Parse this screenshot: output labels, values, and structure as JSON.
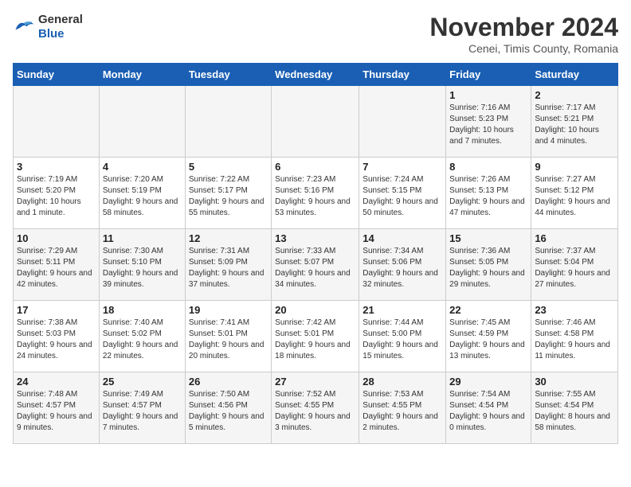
{
  "header": {
    "logo_general": "General",
    "logo_blue": "Blue",
    "main_title": "November 2024",
    "subtitle": "Cenei, Timis County, Romania"
  },
  "columns": [
    "Sunday",
    "Monday",
    "Tuesday",
    "Wednesday",
    "Thursday",
    "Friday",
    "Saturday"
  ],
  "weeks": [
    [
      {
        "day": "",
        "info": ""
      },
      {
        "day": "",
        "info": ""
      },
      {
        "day": "",
        "info": ""
      },
      {
        "day": "",
        "info": ""
      },
      {
        "day": "",
        "info": ""
      },
      {
        "day": "1",
        "info": "Sunrise: 7:16 AM\nSunset: 5:23 PM\nDaylight: 10 hours and 7 minutes."
      },
      {
        "day": "2",
        "info": "Sunrise: 7:17 AM\nSunset: 5:21 PM\nDaylight: 10 hours and 4 minutes."
      }
    ],
    [
      {
        "day": "3",
        "info": "Sunrise: 7:19 AM\nSunset: 5:20 PM\nDaylight: 10 hours and 1 minute."
      },
      {
        "day": "4",
        "info": "Sunrise: 7:20 AM\nSunset: 5:19 PM\nDaylight: 9 hours and 58 minutes."
      },
      {
        "day": "5",
        "info": "Sunrise: 7:22 AM\nSunset: 5:17 PM\nDaylight: 9 hours and 55 minutes."
      },
      {
        "day": "6",
        "info": "Sunrise: 7:23 AM\nSunset: 5:16 PM\nDaylight: 9 hours and 53 minutes."
      },
      {
        "day": "7",
        "info": "Sunrise: 7:24 AM\nSunset: 5:15 PM\nDaylight: 9 hours and 50 minutes."
      },
      {
        "day": "8",
        "info": "Sunrise: 7:26 AM\nSunset: 5:13 PM\nDaylight: 9 hours and 47 minutes."
      },
      {
        "day": "9",
        "info": "Sunrise: 7:27 AM\nSunset: 5:12 PM\nDaylight: 9 hours and 44 minutes."
      }
    ],
    [
      {
        "day": "10",
        "info": "Sunrise: 7:29 AM\nSunset: 5:11 PM\nDaylight: 9 hours and 42 minutes."
      },
      {
        "day": "11",
        "info": "Sunrise: 7:30 AM\nSunset: 5:10 PM\nDaylight: 9 hours and 39 minutes."
      },
      {
        "day": "12",
        "info": "Sunrise: 7:31 AM\nSunset: 5:09 PM\nDaylight: 9 hours and 37 minutes."
      },
      {
        "day": "13",
        "info": "Sunrise: 7:33 AM\nSunset: 5:07 PM\nDaylight: 9 hours and 34 minutes."
      },
      {
        "day": "14",
        "info": "Sunrise: 7:34 AM\nSunset: 5:06 PM\nDaylight: 9 hours and 32 minutes."
      },
      {
        "day": "15",
        "info": "Sunrise: 7:36 AM\nSunset: 5:05 PM\nDaylight: 9 hours and 29 minutes."
      },
      {
        "day": "16",
        "info": "Sunrise: 7:37 AM\nSunset: 5:04 PM\nDaylight: 9 hours and 27 minutes."
      }
    ],
    [
      {
        "day": "17",
        "info": "Sunrise: 7:38 AM\nSunset: 5:03 PM\nDaylight: 9 hours and 24 minutes."
      },
      {
        "day": "18",
        "info": "Sunrise: 7:40 AM\nSunset: 5:02 PM\nDaylight: 9 hours and 22 minutes."
      },
      {
        "day": "19",
        "info": "Sunrise: 7:41 AM\nSunset: 5:01 PM\nDaylight: 9 hours and 20 minutes."
      },
      {
        "day": "20",
        "info": "Sunrise: 7:42 AM\nSunset: 5:01 PM\nDaylight: 9 hours and 18 minutes."
      },
      {
        "day": "21",
        "info": "Sunrise: 7:44 AM\nSunset: 5:00 PM\nDaylight: 9 hours and 15 minutes."
      },
      {
        "day": "22",
        "info": "Sunrise: 7:45 AM\nSunset: 4:59 PM\nDaylight: 9 hours and 13 minutes."
      },
      {
        "day": "23",
        "info": "Sunrise: 7:46 AM\nSunset: 4:58 PM\nDaylight: 9 hours and 11 minutes."
      }
    ],
    [
      {
        "day": "24",
        "info": "Sunrise: 7:48 AM\nSunset: 4:57 PM\nDaylight: 9 hours and 9 minutes."
      },
      {
        "day": "25",
        "info": "Sunrise: 7:49 AM\nSunset: 4:57 PM\nDaylight: 9 hours and 7 minutes."
      },
      {
        "day": "26",
        "info": "Sunrise: 7:50 AM\nSunset: 4:56 PM\nDaylight: 9 hours and 5 minutes."
      },
      {
        "day": "27",
        "info": "Sunrise: 7:52 AM\nSunset: 4:55 PM\nDaylight: 9 hours and 3 minutes."
      },
      {
        "day": "28",
        "info": "Sunrise: 7:53 AM\nSunset: 4:55 PM\nDaylight: 9 hours and 2 minutes."
      },
      {
        "day": "29",
        "info": "Sunrise: 7:54 AM\nSunset: 4:54 PM\nDaylight: 9 hours and 0 minutes."
      },
      {
        "day": "30",
        "info": "Sunrise: 7:55 AM\nSunset: 4:54 PM\nDaylight: 8 hours and 58 minutes."
      }
    ]
  ]
}
